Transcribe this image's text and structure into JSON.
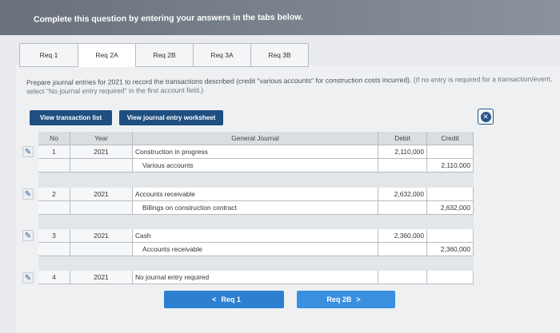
{
  "banner": {
    "text": "Complete this question by entering your answers in the tabs below."
  },
  "tabs": [
    {
      "label": "Req 1"
    },
    {
      "label": "Req 2A"
    },
    {
      "label": "Req 2B"
    },
    {
      "label": "Req 3A"
    },
    {
      "label": "Req 3B"
    }
  ],
  "instructions": {
    "main": "Prepare journal entries for 2021 to record the transactions described (credit \"various accounts\" for construction costs incurred).",
    "note": "(If no entry is required for a transaction/event, select \"No journal entry required\" in the first account field.)"
  },
  "buttons": {
    "view_transactions": "View transaction list",
    "view_worksheet": "View journal entry worksheet",
    "close_icon": "circle-x"
  },
  "journal": {
    "headers": {
      "no": "No",
      "year": "Year",
      "journal": "General Journal",
      "debit": "Debit",
      "credit": "Credit"
    },
    "entries": [
      {
        "no": "1",
        "year": "2021",
        "debit_account": "Construction in progress",
        "debit": "2,110,000",
        "credit_account": "Various accounts",
        "credit": "2,110,000"
      },
      {
        "no": "2",
        "year": "2021",
        "debit_account": "Accounts receivable",
        "debit": "2,632,000",
        "credit_account": "Billings on construction contract",
        "credit": "2,632,000"
      },
      {
        "no": "3",
        "year": "2021",
        "debit_account": "Cash",
        "debit": "2,360,000",
        "credit_account": "Accounts receivable",
        "credit": "2,360,000"
      },
      {
        "no": "4",
        "year": "2021",
        "debit_account": "No journal entry required",
        "debit": "",
        "credit_account": "",
        "credit": ""
      }
    ]
  },
  "nav": {
    "prev": "Req 1",
    "next": "Req 2B",
    "prev_icon": "<",
    "next_icon": ">"
  }
}
